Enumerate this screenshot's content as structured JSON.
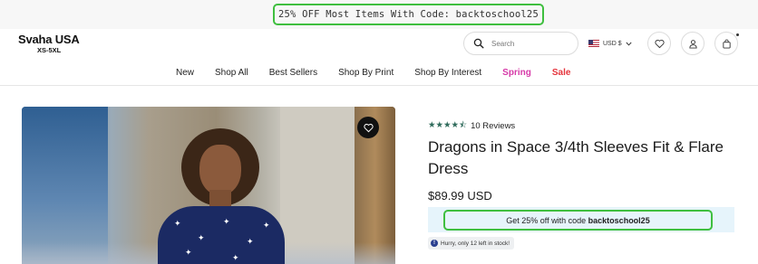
{
  "promo": {
    "text": "25% OFF Most Items With Code: backtoschool25"
  },
  "brand": {
    "name": "Svaha USA",
    "tagline": "XS-5XL"
  },
  "header": {
    "search_placeholder": "Search",
    "currency_label": "USD $",
    "icons": [
      "search-icon",
      "us-flag-icon",
      "chevron-down-icon",
      "heart-icon",
      "account-icon",
      "bag-icon"
    ]
  },
  "nav": {
    "items": [
      "New",
      "Shop All",
      "Best Sellers",
      "Shop By Print",
      "Shop By Interest",
      "Spring",
      "Sale"
    ]
  },
  "product": {
    "rating": 4.5,
    "stars": "★★★★⯪",
    "reviews_label": "10 Reviews",
    "title": "Dragons in Space 3/4th Sleeves Fit & Flare Dress",
    "price": "$89.99 USD",
    "discount_prefix": "Get 25% off with code ",
    "discount_code": "backtoschool25",
    "stock_text": "Hurry, only 12 left in stock!"
  },
  "colors": {
    "highlight_border": "#3fbf3f",
    "star_color": "#2f6b5b",
    "spring_color": "#d63aa8",
    "sale_color": "#e5343c",
    "discount_bg": "#e6f4fb"
  }
}
